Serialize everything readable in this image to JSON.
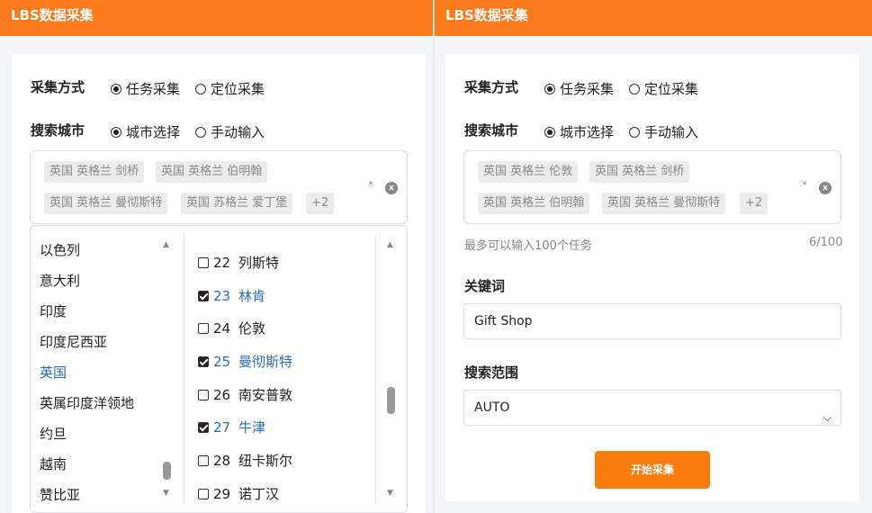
{
  "left": {
    "title": "LBS数据采集",
    "collect_method": {
      "label": "采集方式",
      "options": [
        "任务采集",
        "定位采集"
      ],
      "selected": 0
    },
    "search_city": {
      "label": "搜索城市",
      "options": [
        "城市选择",
        "手动输入"
      ],
      "selected": 0
    },
    "tags": [
      "英国 英格兰 剑桥",
      "英国 英格兰 伯明翰",
      "英国 英格兰 曼彻斯特",
      "英国 苏格兰 爱丁堡",
      "+2"
    ],
    "countries": [
      "以色列",
      "意大利",
      "印度",
      "印度尼西亚",
      "英国",
      "英属印度洋领地",
      "约旦",
      "越南",
      "赞比亚"
    ],
    "active_country": "英国",
    "cities": [
      {
        "num": "22",
        "name": "列斯特",
        "checked": false
      },
      {
        "num": "23",
        "name": "林肯",
        "checked": true
      },
      {
        "num": "24",
        "name": "伦敦",
        "checked": false
      },
      {
        "num": "25",
        "name": "曼彻斯特",
        "checked": true
      },
      {
        "num": "26",
        "name": "南安普敦",
        "checked": false
      },
      {
        "num": "27",
        "name": "牛津",
        "checked": true
      },
      {
        "num": "28",
        "name": "纽卡斯尔",
        "checked": false
      },
      {
        "num": "29",
        "name": "诺丁汉",
        "checked": false
      }
    ]
  },
  "right": {
    "title": "LBS数据采集",
    "collect_method": {
      "label": "采集方式",
      "options": [
        "任务采集",
        "定位采集"
      ],
      "selected": 0
    },
    "search_city": {
      "label": "搜索城市",
      "options": [
        "城市选择",
        "手动输入"
      ],
      "selected": 0
    },
    "tags": [
      "英国 英格兰 伦敦",
      "英国 英格兰 剑桥",
      "英国 英格兰 伯明翰",
      "英国 英格兰 曼彻斯特",
      "+2"
    ],
    "hint": "最多可以输入100个任务",
    "count": "6/100",
    "keyword": {
      "label": "关键词",
      "value": "Gift Shop"
    },
    "range": {
      "label": "搜索范围",
      "value": "AUTO"
    },
    "start_button": "开始采集"
  },
  "colors": {
    "brand": "#fa7a1c",
    "link": "#2a6db5"
  },
  "icons": [
    "chevron-up-icon",
    "chevron-down-icon",
    "clear-icon",
    "scroll-up-icon",
    "scroll-down-icon"
  ]
}
